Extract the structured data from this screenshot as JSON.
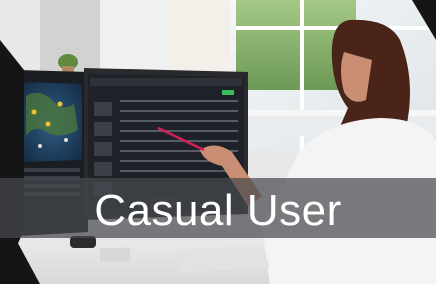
{
  "caption": {
    "text": "Casual User"
  },
  "colors": {
    "wall": "#e6e6e6",
    "window_light": "#eef3f6",
    "greenery": "#7fae5a",
    "desk": "#f2f2f2",
    "monitor_frame": "#2a2a2e",
    "screen_dark": "#1e2127",
    "map_blue": "#21456b",
    "accent_green": "#3bbf5a",
    "hair": "#4a2418",
    "shirt": "#f4f4f4",
    "skin": "#c98e74",
    "frame_black": "#151515",
    "caption_band": "#464a4e"
  },
  "icons": [
    "person-photo",
    "monitor",
    "keyboard",
    "pen"
  ]
}
